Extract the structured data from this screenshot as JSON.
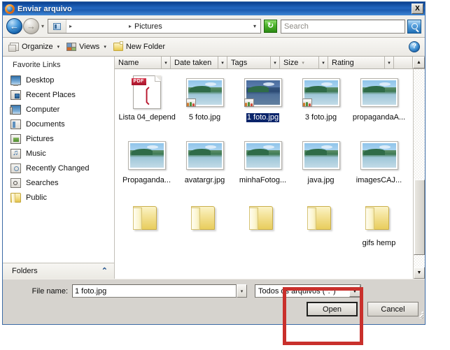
{
  "window": {
    "title": "Enviar arquivo",
    "titlebar_icon": "firefox-globe-icon",
    "close_label": "X",
    "accent_titlebar": "#1b5bb0",
    "dialog_bg": "#d6d3ce"
  },
  "addressbar": {
    "back_glyph": "←",
    "forward_glyph": "→",
    "history_caret": "▾",
    "breadcrumb": {
      "folder_icon": "pictures-folder-icon",
      "separator": "▸",
      "blank_segment": "",
      "current": "Pictures",
      "dropdown_caret": "▾"
    },
    "refresh_glyph": "↻",
    "search": {
      "placeholder": "Search",
      "value": "",
      "button_icon": "magnifier-icon"
    }
  },
  "toolbar": {
    "organize_label": "Organize",
    "views_label": "Views",
    "new_folder_label": "New Folder",
    "caret": "▾",
    "help_label": "?"
  },
  "sidebar": {
    "header": "Favorite Links",
    "items": [
      {
        "label": "Desktop",
        "icon": "desktop-icon"
      },
      {
        "label": "Recent Places",
        "icon": "recent-places-icon"
      },
      {
        "label": "Computer",
        "icon": "computer-icon"
      },
      {
        "label": "Documents",
        "icon": "documents-icon"
      },
      {
        "label": "Pictures",
        "icon": "pictures-icon"
      },
      {
        "label": "Music",
        "icon": "music-icon"
      },
      {
        "label": "Recently Changed",
        "icon": "recently-changed-icon"
      },
      {
        "label": "Searches",
        "icon": "searches-icon"
      },
      {
        "label": "Public",
        "icon": "public-folder-icon"
      }
    ],
    "folders_section": {
      "label": "Folders",
      "expander": "⌃"
    }
  },
  "filepane": {
    "columns": [
      {
        "label": "Name",
        "sort_indicator": ""
      },
      {
        "label": "Date taken",
        "sort_indicator": ""
      },
      {
        "label": "Tags",
        "sort_indicator": ""
      },
      {
        "label": "Size",
        "sort_indicator": "▾"
      },
      {
        "label": "Rating",
        "sort_indicator": ""
      }
    ],
    "column_split_caret": "▾",
    "header_scroll_up": "▲",
    "scrollbar": {
      "up_arrow": "▲",
      "down_arrow": "▼"
    },
    "rows": [
      [
        {
          "name": "Lista 04_depend...",
          "type": "pdf",
          "selected": false,
          "pdf_banner": "PDF",
          "swirl": "❄"
        },
        {
          "name": "5 foto.jpg",
          "type": "photo",
          "selected": false
        },
        {
          "name": "1 foto.jpg",
          "type": "photo",
          "selected": true
        },
        {
          "name": "3 foto.jpg",
          "type": "photo",
          "selected": false
        },
        {
          "name": "propagandaA...",
          "type": "photo",
          "selected": false
        }
      ],
      [
        {
          "name": "Propaganda...",
          "type": "photo",
          "selected": false
        },
        {
          "name": "avatargr.jpg",
          "type": "photo",
          "selected": false
        },
        {
          "name": "minhaFotog...",
          "type": "photo",
          "selected": false
        },
        {
          "name": "java.jpg",
          "type": "photo",
          "selected": false
        },
        {
          "name": "imagesCAJ...",
          "type": "photo",
          "selected": false
        }
      ],
      [
        {
          "name": "",
          "type": "folder",
          "selected": false
        },
        {
          "name": "",
          "type": "folder",
          "selected": false
        },
        {
          "name": "",
          "type": "folder",
          "selected": false
        },
        {
          "name": "",
          "type": "folder",
          "selected": false
        },
        {
          "name": "gifs hemp",
          "type": "folder",
          "selected": false
        }
      ]
    ]
  },
  "footer": {
    "file_name_label": "File name:",
    "file_name_value": "1 foto.jpg",
    "file_name_caret": "▾",
    "filter_value": "Todos os arquivos (*.*)",
    "filter_caret": "▼",
    "open_label": "Open",
    "cancel_label": "Cancel"
  },
  "annotation": {
    "shape": "rectangle",
    "color": "#c9302c",
    "target": "open-button"
  }
}
